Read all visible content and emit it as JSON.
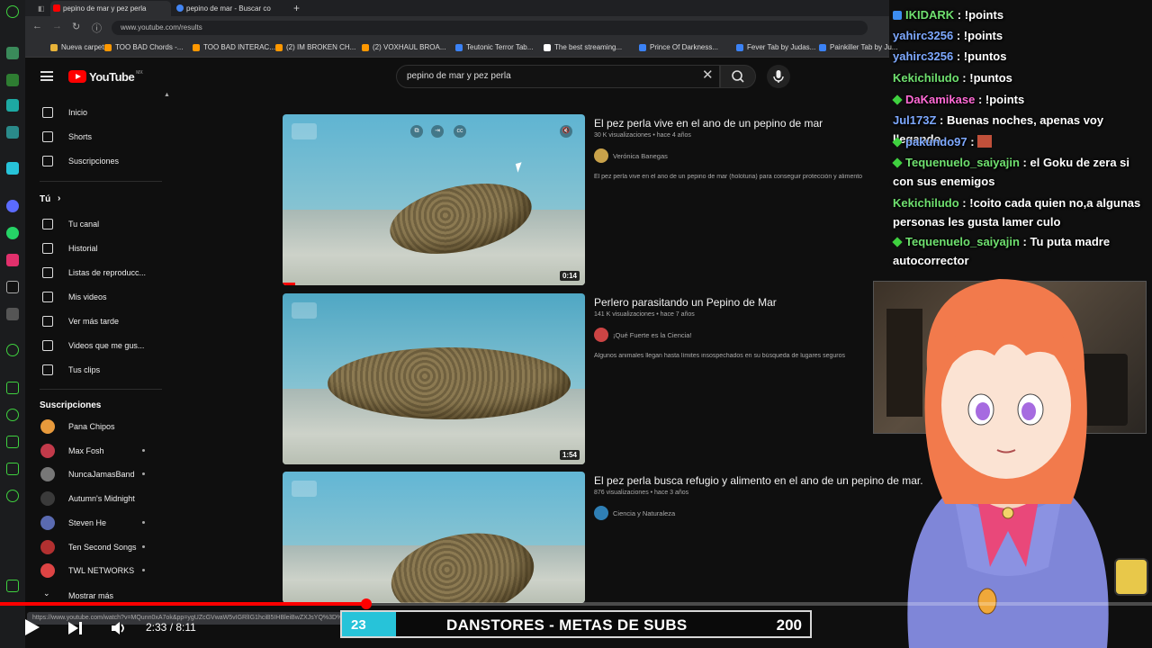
{
  "browser": {
    "tabs": [
      {
        "label": "pepino de mar y pez perla",
        "active": true,
        "fav_color": "#ff0000"
      },
      {
        "label": "pepino de mar - Buscar co",
        "active": false,
        "fav_color": "#4285f4"
      }
    ],
    "url": "www.youtube.com/results",
    "bookmarks": [
      {
        "label": "Nueva carpeta",
        "color": "#e8b339"
      },
      {
        "label": "TOO BAD Chords -...",
        "color": "#ff9800"
      },
      {
        "label": "TOO BAD INTERAC...",
        "color": "#ff9800"
      },
      {
        "label": "(2) IM BROKEN CH...",
        "color": "#ff9800"
      },
      {
        "label": "(2) VOXHAUL BROA...",
        "color": "#ff9800"
      },
      {
        "label": "Teutonic Terror Tab...",
        "color": "#3b82f6"
      },
      {
        "label": "The best streaming...",
        "color": "#ffffff"
      },
      {
        "label": "Prince Of Darkness...",
        "color": "#3b82f6"
      },
      {
        "label": "Fever Tab by Judas...",
        "color": "#3b82f6"
      },
      {
        "label": "Painkiller Tab by Ju...",
        "color": "#3b82f6"
      }
    ]
  },
  "youtube": {
    "logo_text": "YouTube",
    "country": "MX",
    "search_query": "pepino de mar y pez perla",
    "sidebar": {
      "main": [
        {
          "label": "Inicio",
          "icon": "home-icon"
        },
        {
          "label": "Shorts",
          "icon": "shorts-icon"
        },
        {
          "label": "Suscripciones",
          "icon": "subscriptions-icon"
        }
      ],
      "you_header": "Tú",
      "you": [
        {
          "label": "Tu canal",
          "icon": "channel-icon"
        },
        {
          "label": "Historial",
          "icon": "history-icon"
        },
        {
          "label": "Listas de reproducc...",
          "icon": "playlist-icon"
        },
        {
          "label": "Mis videos",
          "icon": "video-icon"
        },
        {
          "label": "Ver más tarde",
          "icon": "clock-icon"
        },
        {
          "label": "Videos que me gus...",
          "icon": "thumbs-up-icon"
        },
        {
          "label": "Tus clips",
          "icon": "scissors-icon"
        }
      ],
      "subs_header": "Suscripciones",
      "subs": [
        {
          "label": "Pana Chipos",
          "color": "#e89a3c",
          "dot": false
        },
        {
          "label": "Max Fosh",
          "color": "#c23a4a",
          "dot": true
        },
        {
          "label": "NuncaJamasBand",
          "color": "#777777",
          "dot": true
        },
        {
          "label": "Autumn's Midnight",
          "color": "#3a3a3a",
          "dot": false
        },
        {
          "label": "Steven He",
          "color": "#5a6ab0",
          "dot": true
        },
        {
          "label": "Ten Second Songs",
          "color": "#b23030",
          "dot": true
        },
        {
          "label": "TWL NETWORKS",
          "color": "#d44",
          "dot": true
        }
      ],
      "more": "Mostrar más"
    },
    "results": [
      {
        "title": "El pez perla vive en el ano de un pepino de mar",
        "meta": "30 K visualizaciones • hace 4 años",
        "channel": "Verónica Banegas",
        "desc": "El pez perla vive en el ano de un pepino de mar (holoturia) para conseguir protección y alimento",
        "duration": "0:14",
        "water_top": "#5fb4d2",
        "chan_color": "#c9a24a"
      },
      {
        "title": "Perlero parasitando un Pepino de Mar",
        "meta": "141 K visualizaciones • hace 7 años",
        "channel": "¡Qué Fuerte es la Ciencia!",
        "desc": "Algunos animales llegan hasta límites insospechados en su búsqueda de lugares seguros",
        "duration": "1:54",
        "water_top": "#4fa7c4",
        "chan_color": "#c44"
      },
      {
        "title": "El pez perla busca refugio y alimento en el ano de un pepino de mar.",
        "meta": "876 visualizaciones • hace 3 años",
        "channel": "Ciencia y Naturaleza",
        "desc": "",
        "duration": "",
        "water_top": "#62b6d4",
        "chan_color": "#2f7fb5"
      }
    ]
  },
  "player": {
    "time": "2:33 / 8:11",
    "hover_url": "https://www.youtube.com/watch?v=MQunn0xA7ok&pp=ygUZcGVwaW5vIGRlIG1hciB5IHBleiBwZXJsYQ%3D%3D",
    "progress": 0.318
  },
  "goal": {
    "current": "23",
    "title": "DANSTORES - METAS DE SUBS",
    "target": "200",
    "progress": 0.115
  },
  "chat": [
    {
      "badge": "twitch",
      "user": "IKIDARK",
      "color": "green",
      "msg": "!points"
    },
    {
      "badge": "",
      "user": "yahirc3256",
      "color": "blue",
      "msg": "!points"
    },
    {
      "badge": "",
      "user": "yahirc3256",
      "color": "blue",
      "msg": "!puntos"
    },
    {
      "badge": "",
      "user": "Kekichiludo",
      "color": "green",
      "msg": "!puntos"
    },
    {
      "badge": "diamond",
      "user": "DaKamikase",
      "color": "pink",
      "msg": "!points"
    },
    {
      "badge": "",
      "user": "Jul173Z",
      "color": "blue",
      "msg": "Buenas noches, apenas voy llegando"
    },
    {
      "badge": "diamond",
      "user": "pakundo97",
      "color": "blue",
      "msg": ""
    },
    {
      "badge": "diamond",
      "user": "Tequenuelo_saiyajin",
      "color": "green",
      "msg": "el Goku de zera si con sus enemigos"
    },
    {
      "badge": "",
      "user": "Kekichiludo",
      "color": "green",
      "msg": "!coito cada quien no,a algunas personas les gusta lamer culo"
    },
    {
      "badge": "diamond",
      "user": "Tequenuelo_saiyajin",
      "color": "green",
      "msg": "Tu puta madre autocorrector"
    }
  ]
}
